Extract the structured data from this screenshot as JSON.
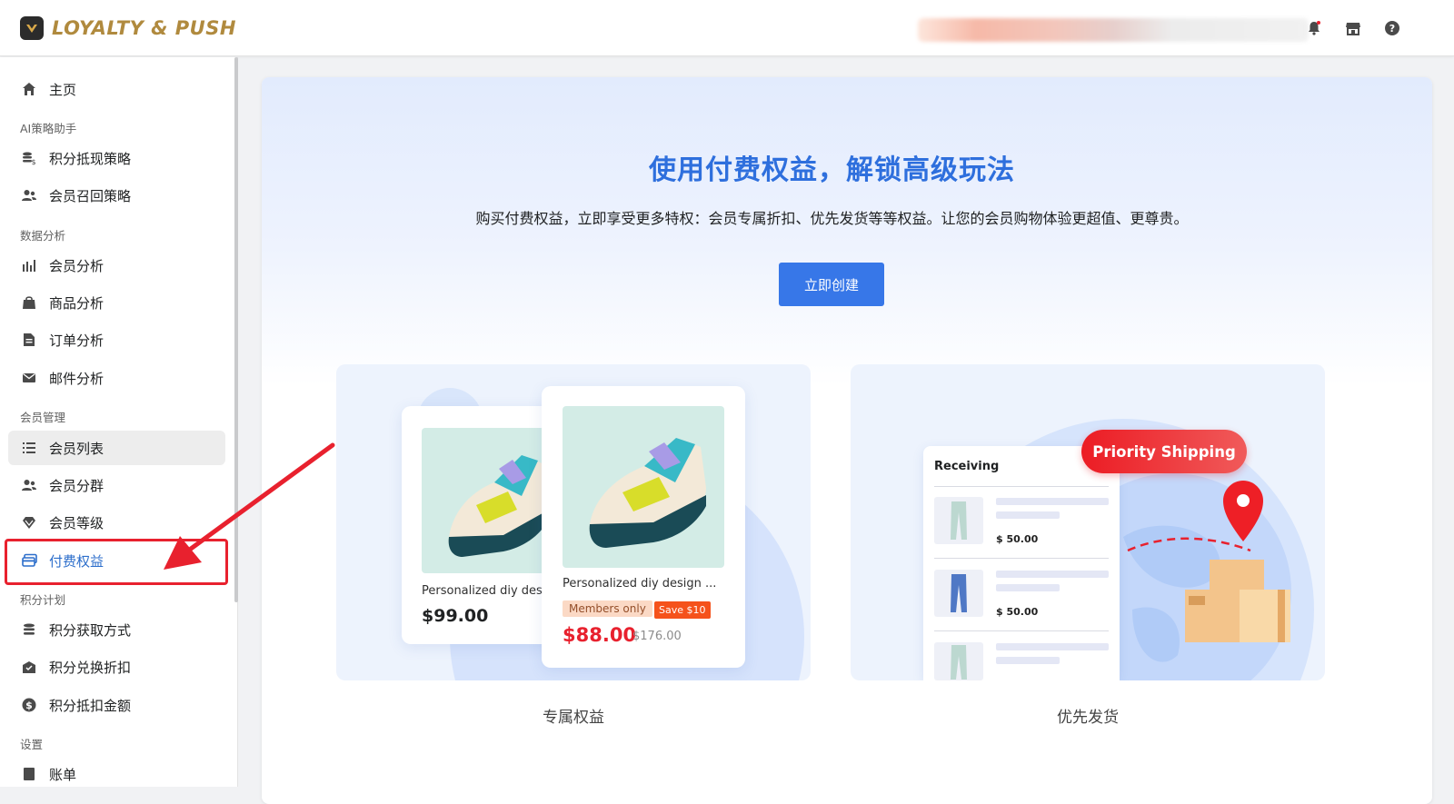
{
  "app": {
    "brand": "LOYALTY & PUSH"
  },
  "header": {
    "icons": [
      "bell-icon",
      "store-icon",
      "help-icon"
    ]
  },
  "sidebar": {
    "home": "主页",
    "sections": {
      "ai": "AI策略助手",
      "data": "数据分析",
      "member": "会员管理",
      "points": "积分计划",
      "settings": "设置"
    },
    "items": {
      "points_cash_strategy": "积分抵现策略",
      "member_recall_strategy": "会员召回策略",
      "member_analysis": "会员分析",
      "product_analysis": "商品分析",
      "order_analysis": "订单分析",
      "email_analysis": "邮件分析",
      "member_list": "会员列表",
      "member_groups": "会员分群",
      "member_levels": "会员等级",
      "paid_benefits": "付费权益",
      "points_earn": "积分获取方式",
      "points_redeem_discount": "积分兑换折扣",
      "points_deduct_amount": "积分抵扣金额",
      "billing": "账单"
    }
  },
  "main": {
    "title": "使用付费权益，解锁高级玩法",
    "subtitle": "购买付费权益，立即享受更多特权：会员专属折扣、优先发货等等权益。让您的会员购物体验更超值、更尊贵。",
    "create_button": "立即创建",
    "cards": {
      "exclusive": {
        "caption": "专属权益",
        "back_product": {
          "name": "Personalized diy design",
          "price": "$99.00"
        },
        "front_product": {
          "name": "Personalized diy design ...",
          "member_badge": "Members only",
          "save_badge": "Save $10",
          "price": "$88.00",
          "original_price": "$176.00"
        }
      },
      "shipping": {
        "caption": "优先发货",
        "panel_title": "Receiving",
        "badge": "Priority Shipping",
        "rows": [
          {
            "price": "$ 50.00"
          },
          {
            "price": "$ 50.00"
          }
        ]
      }
    }
  },
  "colors": {
    "accent": "#3777e8",
    "brand": "#b08a3e",
    "highlight": "#e8212e"
  }
}
